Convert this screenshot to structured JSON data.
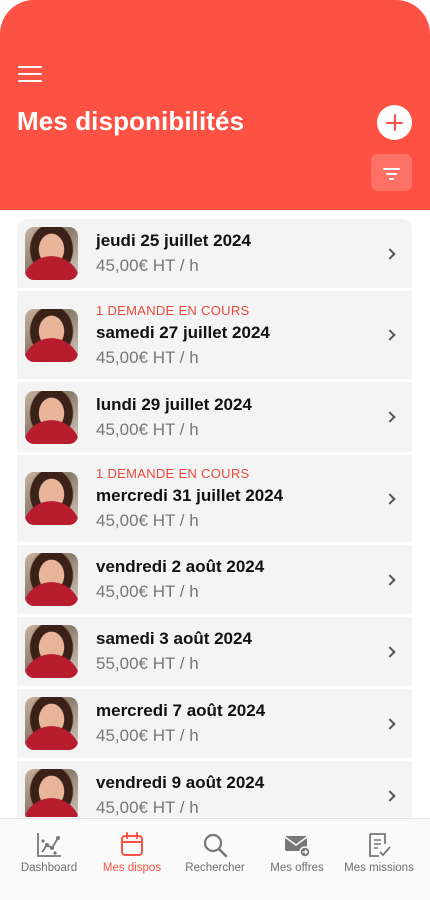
{
  "header": {
    "title": "Mes disponibilités",
    "color": "#fd5143"
  },
  "availabilities": [
    {
      "tag": "",
      "date": "jeudi 25 juillet 2024",
      "price": "45,00€ HT / h"
    },
    {
      "tag": "1 DEMANDE EN COURS",
      "date": "samedi 27 juillet 2024",
      "price": "45,00€ HT / h"
    },
    {
      "tag": "",
      "date": "lundi 29 juillet 2024",
      "price": "45,00€ HT / h"
    },
    {
      "tag": "1 DEMANDE EN COURS",
      "date": "mercredi 31 juillet 2024",
      "price": "45,00€ HT / h"
    },
    {
      "tag": "",
      "date": "vendredi 2 août 2024",
      "price": "45,00€ HT / h"
    },
    {
      "tag": "",
      "date": "samedi 3 août 2024",
      "price": "55,00€ HT / h"
    },
    {
      "tag": "",
      "date": "mercredi 7 août 2024",
      "price": "45,00€ HT / h"
    },
    {
      "tag": "",
      "date": "vendredi 9 août 2024",
      "price": "45,00€ HT / h"
    }
  ],
  "tabs": [
    {
      "label": "Dashboard",
      "icon": "chart-icon",
      "active": false
    },
    {
      "label": "Mes dispos",
      "icon": "calendar-icon",
      "active": true
    },
    {
      "label": "Rechercher",
      "icon": "search-icon",
      "active": false
    },
    {
      "label": "Mes offres",
      "icon": "mail-icon",
      "active": false
    },
    {
      "label": "Mes missions",
      "icon": "document-icon",
      "active": false
    }
  ]
}
